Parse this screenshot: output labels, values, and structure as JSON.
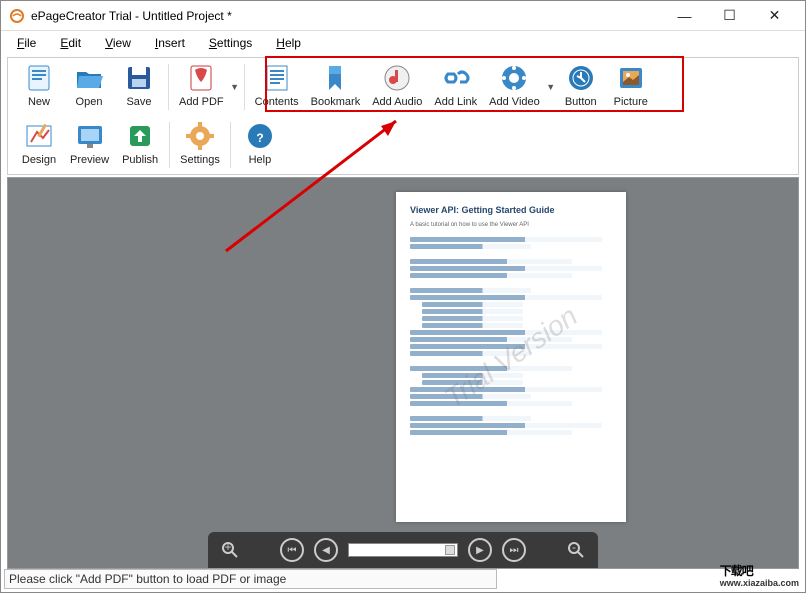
{
  "window": {
    "title": "ePageCreator Trial - Untitled Project *"
  },
  "menu": {
    "file": "File",
    "edit": "Edit",
    "view": "View",
    "insert": "Insert",
    "settings": "Settings",
    "help": "Help"
  },
  "toolbar1": {
    "new": "New",
    "open": "Open",
    "save": "Save",
    "addpdf": "Add PDF",
    "contents": "Contents",
    "bookmark": "Bookmark",
    "addaudio": "Add Audio",
    "addlink": "Add Link",
    "addvideo": "Add Video",
    "button": "Button",
    "picture": "Picture"
  },
  "toolbar2": {
    "design": "Design",
    "preview": "Preview",
    "publish": "Publish",
    "settings": "Settings",
    "help": "Help"
  },
  "document": {
    "title": "Viewer API: Getting Started Guide",
    "subtitle": "A basic tutorial on how to use the Viewer API",
    "watermark": "Trial Version"
  },
  "status": {
    "text": "Please click \"Add PDF\" button to load PDF or image"
  },
  "brand": {
    "cn": "下载吧",
    "url": "www.xiazaiba.com"
  }
}
